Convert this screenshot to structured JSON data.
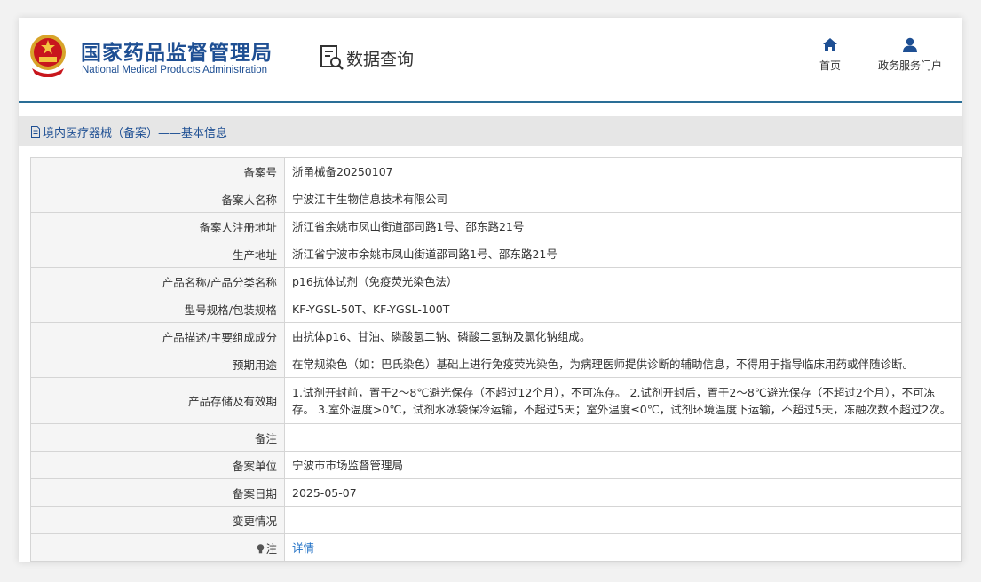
{
  "header": {
    "org_cn": "国家药品监督管理局",
    "org_en": "National Medical Products Administration",
    "section_title": "数据查询",
    "nav": [
      {
        "label": "首页",
        "icon": "home-icon"
      },
      {
        "label": "政务服务门户",
        "icon": "user-icon"
      }
    ]
  },
  "breadcrumb": {
    "icon": "document-icon",
    "text": "境内医疗器械（备案）——基本信息"
  },
  "rows": [
    {
      "label": "备案号",
      "value": "浙甬械备20250107"
    },
    {
      "label": "备案人名称",
      "value": "宁波江丰生物信息技术有限公司"
    },
    {
      "label": "备案人注册地址",
      "value": "浙江省余姚市凤山街道邵司路1号、邵东路21号"
    },
    {
      "label": "生产地址",
      "value": "浙江省宁波市余姚市凤山街道邵司路1号、邵东路21号"
    },
    {
      "label": "产品名称/产品分类名称",
      "value": "p16抗体试剂（免疫荧光染色法）"
    },
    {
      "label": "型号规格/包装规格",
      "value": "KF-YGSL-50T、KF-YGSL-100T"
    },
    {
      "label": "产品描述/主要组成成分",
      "value": "由抗体p16、甘油、磷酸氢二钠、磷酸二氢钠及氯化钠组成。"
    },
    {
      "label": "预期用途",
      "value": "在常规染色（如：巴氏染色）基础上进行免疫荧光染色，为病理医师提供诊断的辅助信息，不得用于指导临床用药或伴随诊断。"
    },
    {
      "label": "产品存储及有效期",
      "value": "1.试剂开封前，置于2～8℃避光保存（不超过12个月），不可冻存。 2.试剂开封后，置于2～8℃避光保存（不超过2个月），不可冻存。 3.室外温度>0℃，试剂水冰袋保冷运输，不超过5天；室外温度≤0℃，试剂环境温度下运输，不超过5天，冻融次数不超过2次。"
    },
    {
      "label": "备注",
      "value": ""
    },
    {
      "label": "备案单位",
      "value": "宁波市市场监督管理局"
    },
    {
      "label": "备案日期",
      "value": "2025-05-07"
    },
    {
      "label": "变更情况",
      "value": ""
    },
    {
      "label": "注",
      "value": "详情",
      "icon": "bulb-icon"
    }
  ],
  "colors": {
    "brand": "#1e4f93",
    "link": "#1e6fc5",
    "band": "#e6e6e6",
    "label_bg": "#f5f5f5"
  }
}
